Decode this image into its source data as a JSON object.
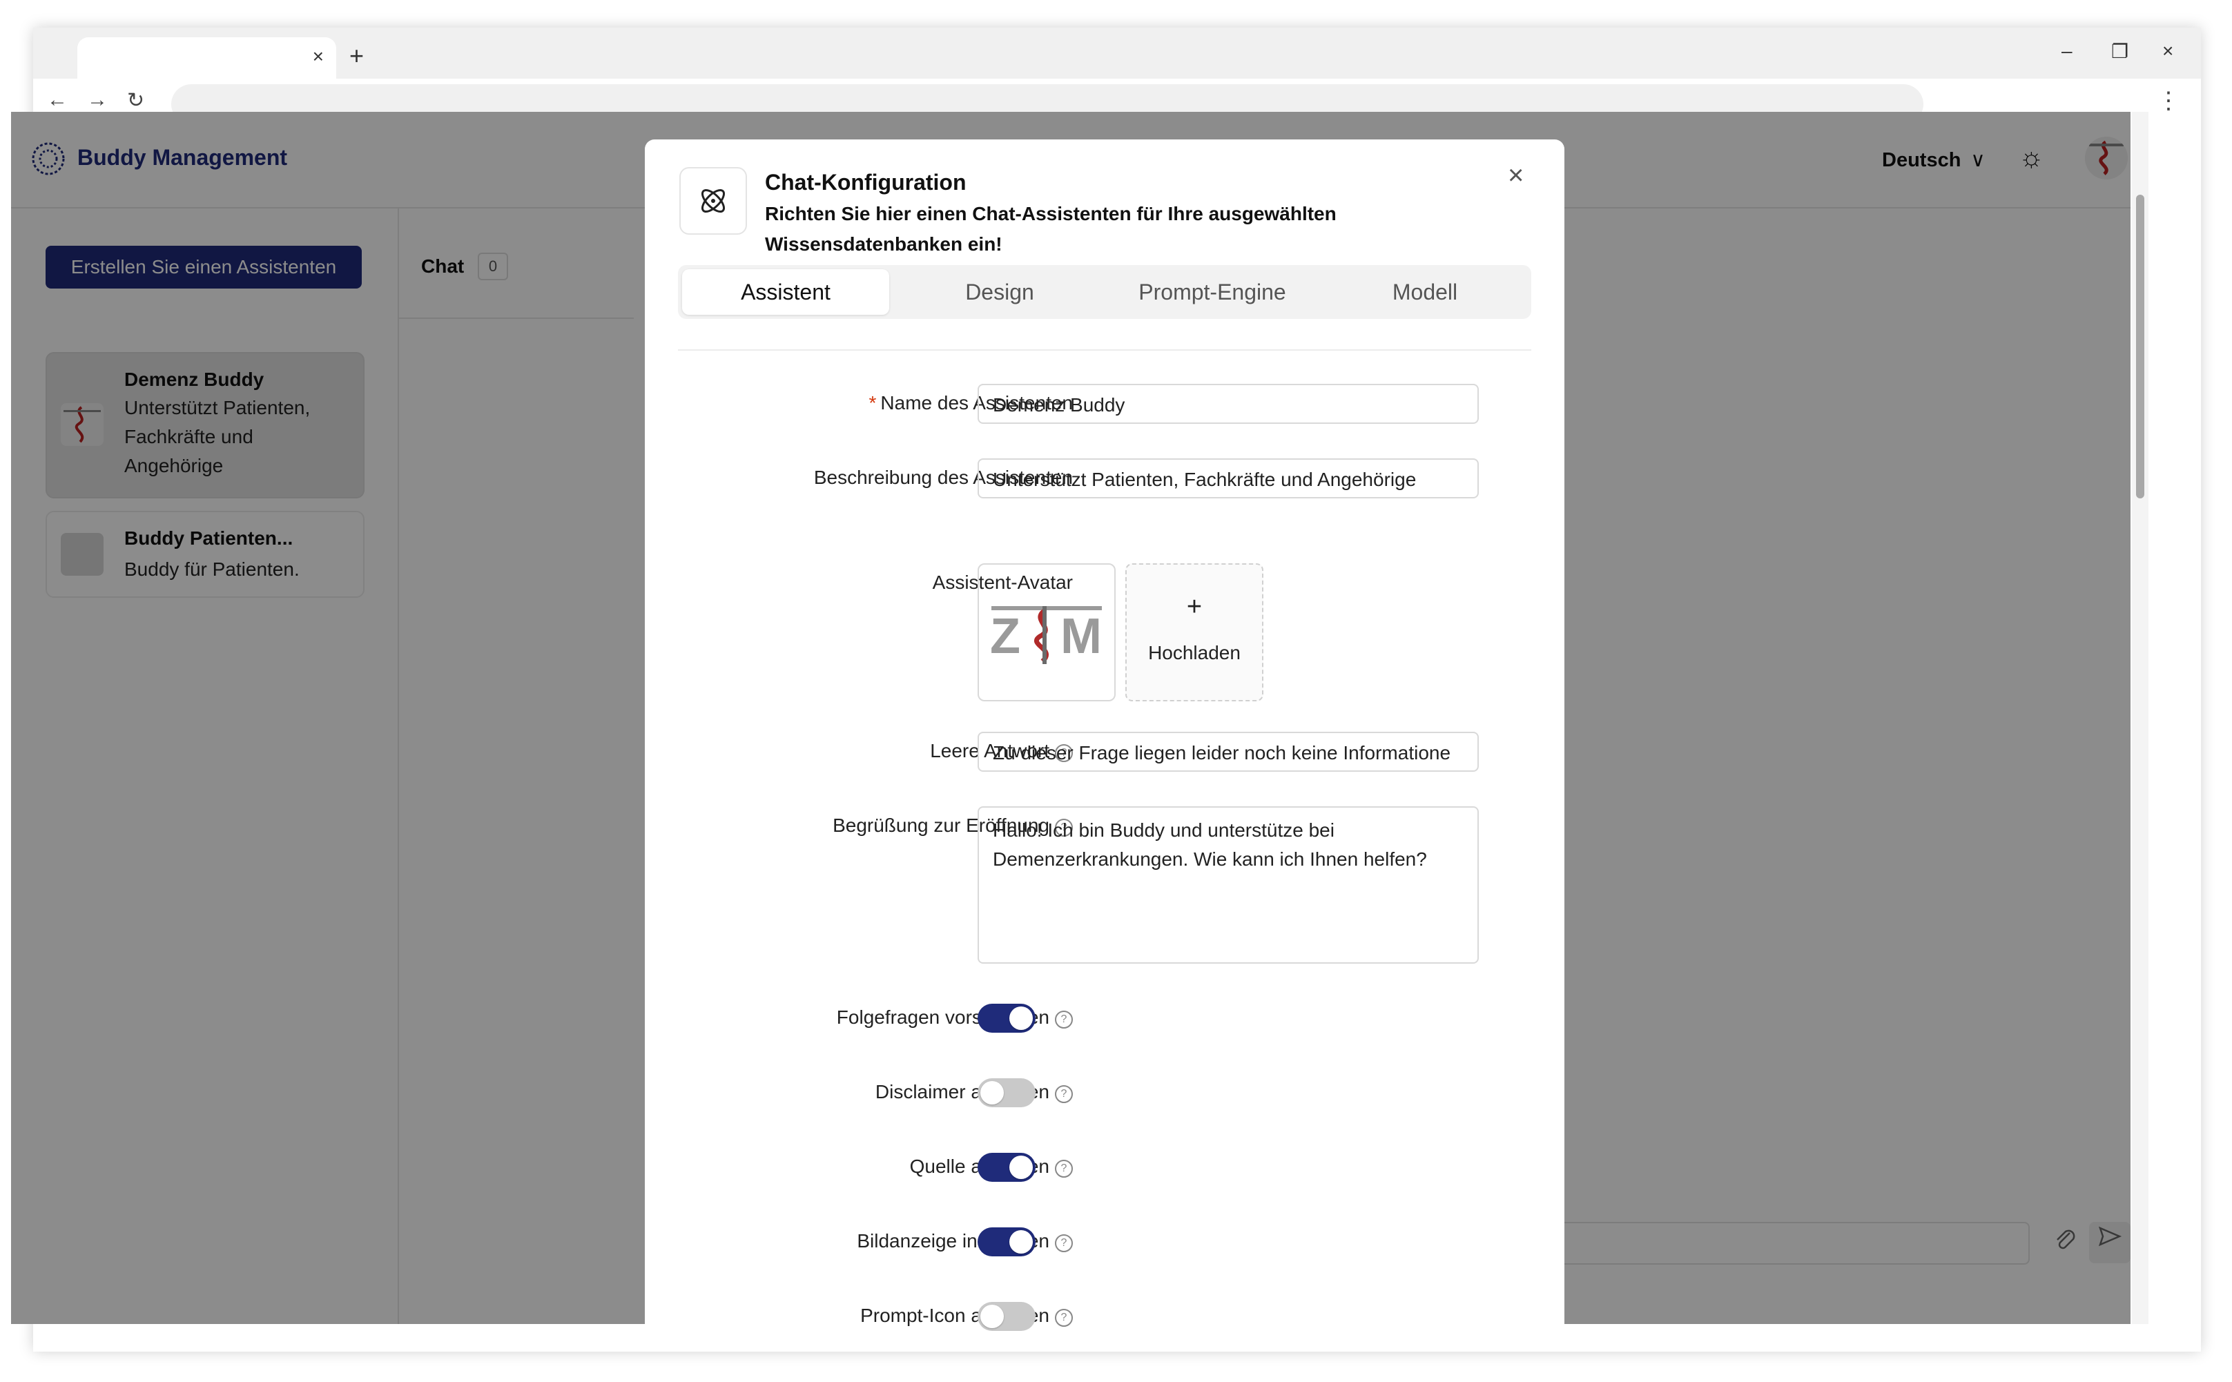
{
  "browser": {
    "tab_close": "×",
    "new_tab": "+",
    "minimize": "–",
    "restore": "❐",
    "close": "×",
    "back": "←",
    "forward": "→",
    "reload": "↻",
    "menu": "⋮"
  },
  "app": {
    "brand": "Buddy Management",
    "language": "Deutsch",
    "language_chevron": "∨",
    "theme_icon": "☼"
  },
  "sidebar": {
    "create_button": "Erstellen Sie einen Assistenten",
    "assistants": [
      {
        "title": "Demenz Buddy",
        "description": "Unterstützt Patienten, Fachkräfte und Angehörige"
      },
      {
        "title": "Buddy Patienten...",
        "description": "Buddy für Patienten."
      }
    ]
  },
  "chat": {
    "label": "Chat",
    "count": "0",
    "attach_icon": "paperclip-icon",
    "send_icon": "send-icon"
  },
  "modal": {
    "title": "Chat-Konfiguration",
    "subtitle": "Richten Sie hier einen Chat-Assistenten für Ihre ausgewählten Wissensdatenbanken ein!",
    "close": "×",
    "tabs": [
      "Assistent",
      "Design",
      "Prompt-Engine",
      "Modell"
    ],
    "active_tab": "Assistent",
    "form": {
      "required_mark": "*",
      "name_label": "Name des Assistenten",
      "name_value": "Demenz Buddy",
      "desc_label": "Beschreibung des Assistenten",
      "desc_value": "Unterstützt Patienten, Fachkräfte und Angehörige",
      "avatar_label": "Assistent-Avatar",
      "upload_plus": "+",
      "upload_label": "Hochladen",
      "empty_label": "Leere Antwort",
      "empty_value": "Zu dieser Frage liegen leider noch keine Informatione",
      "greeting_label": "Begrüßung zur Eröffnung",
      "greeting_value": "Hallo! Ich bin Buddy und unterstütze bei Demenzerkrankungen. Wie kann ich Ihnen helfen?",
      "help_glyph": "?",
      "toggles": [
        {
          "label": "Folgefragen vorschlagen",
          "on": true
        },
        {
          "label": "Disclaimer anzeigen",
          "on": false
        },
        {
          "label": "Quelle anzeigen",
          "on": true
        },
        {
          "label": "Bildanzeige in Quellen",
          "on": true
        },
        {
          "label": "Prompt-Icon anzeigen",
          "on": false
        }
      ]
    }
  },
  "colors": {
    "brand": "#1f2b7a",
    "required": "#d4380d",
    "toggle_off": "#c9c9c9"
  }
}
